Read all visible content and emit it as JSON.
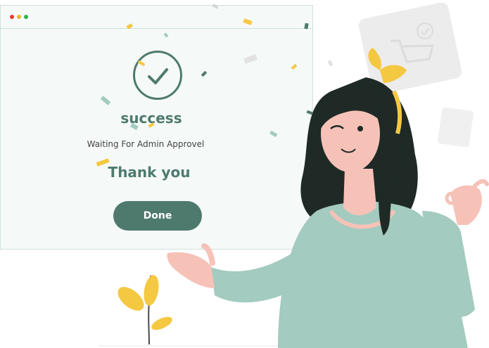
{
  "dialog": {
    "title": "success",
    "message": "Waiting For Admin Approvel",
    "thanks": "Thank you",
    "done_label": "Done"
  },
  "colors": {
    "accent": "#4e7a6e",
    "window_bg": "#f5f9f8",
    "confetti_yellow": "#f5c842",
    "shirt": "#a3cbbf"
  },
  "icons": [
    "check-icon",
    "shopping-cart-icon"
  ]
}
